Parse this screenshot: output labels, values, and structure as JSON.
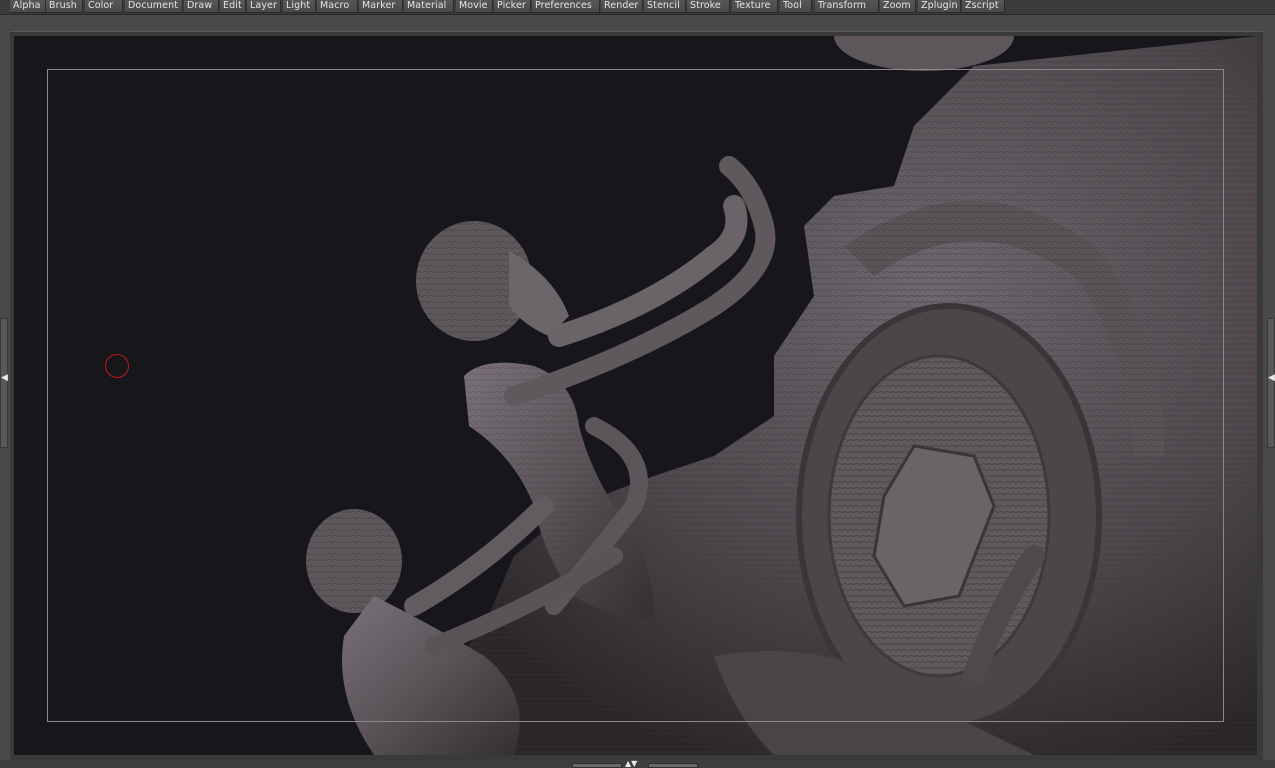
{
  "menu": {
    "items": [
      "Alpha",
      "Brush",
      "Color",
      "Document",
      "Draw",
      "Edit",
      "Layer",
      "Light",
      "Macro",
      "Marker",
      "Material",
      "Movie",
      "Picker",
      "Preferences",
      "Render",
      "Stencil",
      "Stroke",
      "Texture",
      "Tool",
      "Transform",
      "Zoom",
      "Zplugin",
      "Zscript"
    ]
  },
  "icons": {
    "left_tray": "chevron-left-right-icon",
    "right_tray": "chevron-left-right-icon",
    "bottom_tray": "chevron-up-down-icon",
    "cursor": "brush-cursor-icon"
  },
  "colors": {
    "background": "#4a4949",
    "viewport": "#17161a",
    "model": "#5a5458",
    "cursor": "#c01818"
  }
}
